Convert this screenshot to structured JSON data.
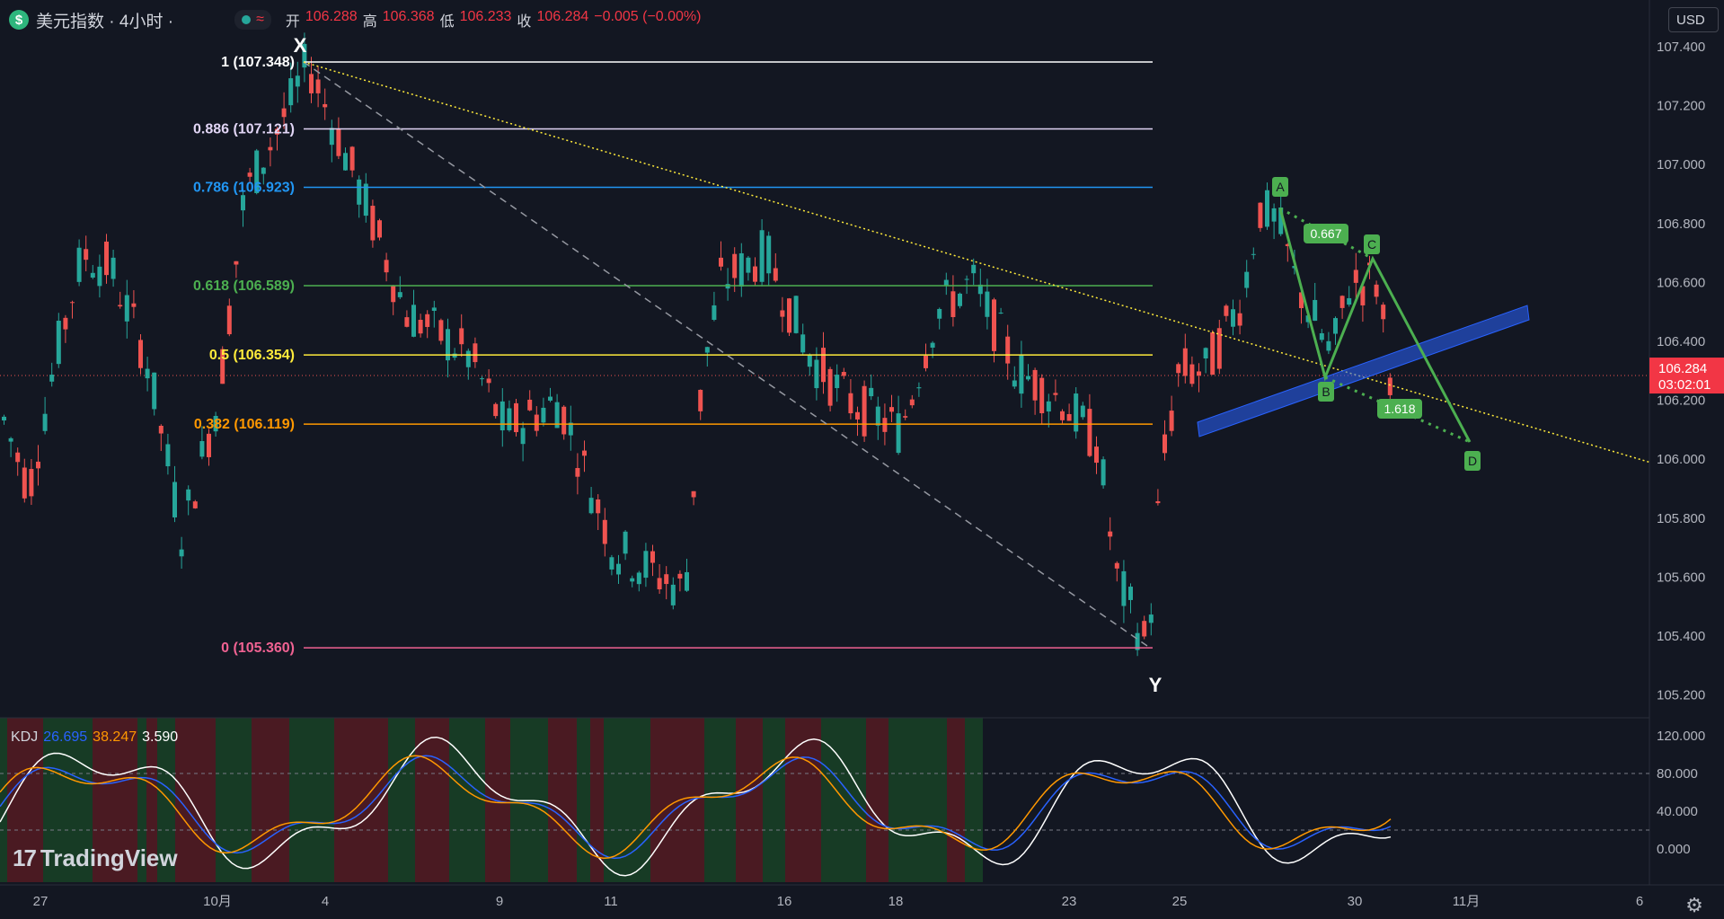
{
  "header": {
    "symbol_icon": "$",
    "title": "美元指数 · 4小时 ·",
    "status_icon": "≈",
    "ohlc": [
      {
        "label": "开",
        "value": "106.288"
      },
      {
        "label": "高",
        "value": "106.368"
      },
      {
        "label": "低",
        "value": "106.233"
      },
      {
        "label": "收",
        "value": "106.284"
      }
    ],
    "change": "−0.005 (−0.00%)"
  },
  "currency": "USD",
  "price_axis": {
    "ticks": [
      "107.400",
      "107.200",
      "107.000",
      "106.800",
      "106.600",
      "106.400",
      "106.200",
      "106.000",
      "105.800",
      "105.600",
      "105.400",
      "105.200"
    ],
    "current_price": "106.284",
    "countdown": "03:02:01"
  },
  "kdj_axis": {
    "ticks": [
      "120.000",
      "80.000",
      "40.000",
      "0.000"
    ]
  },
  "time_axis": {
    "labels": [
      "27",
      "10月",
      "4",
      "9",
      "11",
      "16",
      "18",
      "23",
      "25",
      "30",
      "11月",
      "6"
    ]
  },
  "fib_levels": [
    {
      "label": "1 (107.348)",
      "color": "#ffffff"
    },
    {
      "label": "0.886 (107.121)",
      "color": "#e1d5f5"
    },
    {
      "label": "0.786 (106.923)",
      "color": "#2196f3"
    },
    {
      "label": "0.618 (106.589)",
      "color": "#4caf50"
    },
    {
      "label": "0.5 (106.354)",
      "color": "#ffeb3b"
    },
    {
      "label": "0.382 (106.119)",
      "color": "#ff9800"
    },
    {
      "label": "0 (105.360)",
      "color": "#f06292"
    }
  ],
  "markers": {
    "x": "X",
    "y": "Y"
  },
  "pattern": {
    "points": [
      "A",
      "B",
      "C",
      "D"
    ],
    "ratios": [
      "0.667",
      "1.618"
    ]
  },
  "kdj_legend": {
    "name": "KDJ",
    "k": "26.695",
    "d": "38.247",
    "j": "3.590"
  },
  "watermark": "TradingView",
  "colors": {
    "up": "#26a69a",
    "down": "#ef5350",
    "bg": "#131722",
    "kdj_k": "#2962ff",
    "kdj_d": "#ff9800"
  }
}
